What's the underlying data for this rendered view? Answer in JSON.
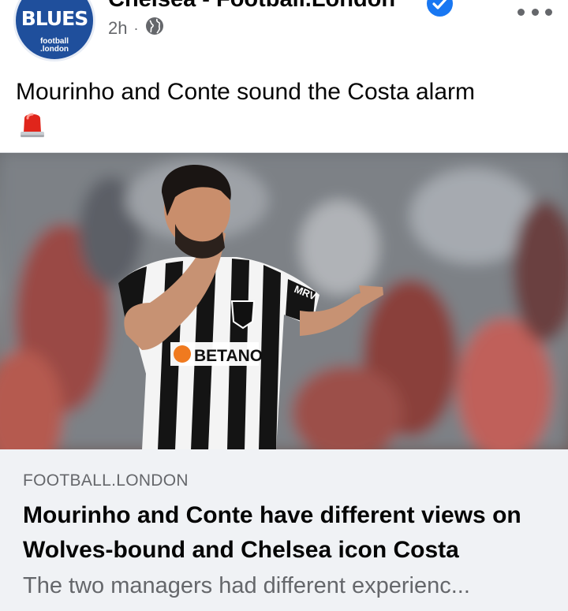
{
  "header": {
    "avatar": {
      "main_text": "BLUES",
      "sub_line1": "football",
      "sub_line2": ".london"
    },
    "page_name": "Chelsea - Football.London",
    "verified_icon": "verified-badge-icon",
    "timestamp": "2h",
    "separator": "·",
    "audience_icon": "globe-icon",
    "more_icon": "more-options-icon"
  },
  "post": {
    "text": "Mourinho and Conte sound the Costa alarm",
    "emoji_icon": "police-siren-icon"
  },
  "image": {
    "kit_sponsor": "BETANO",
    "sleeve_text": "MRV"
  },
  "link_preview": {
    "domain": "FOOTBALL.LONDON",
    "title": "Mourinho and Conte have different views on Wolves-bound and Chelsea icon Costa",
    "description": "The two managers had different experienc..."
  },
  "colors": {
    "brand_blue": "#1f4f9c",
    "verified_blue": "#1877f2",
    "secondary_text": "#65676b",
    "link_box_bg": "#f0f2f5"
  }
}
